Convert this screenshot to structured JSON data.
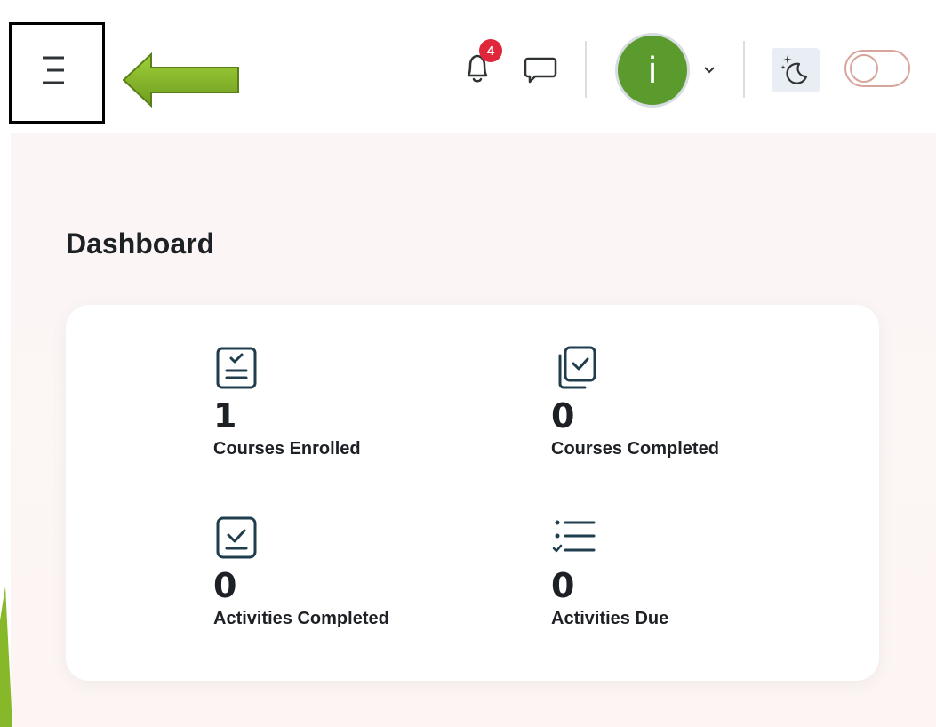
{
  "header": {
    "notifications": {
      "count": "4",
      "icon": "bell-icon"
    },
    "messages": {
      "icon": "chat-bubble-icon"
    },
    "user": {
      "initial": "i",
      "avatar_color": "#5b9a2c"
    },
    "theme": {
      "icon": "moon-stars-icon",
      "toggle_on": false
    }
  },
  "dashboard": {
    "title": "Dashboard",
    "stats": [
      {
        "value": "1",
        "label": "Courses Enrolled",
        "icon": "clipboard-check-icon"
      },
      {
        "value": "0",
        "label": "Courses Completed",
        "icon": "stacked-check-icon"
      },
      {
        "value": "0",
        "label": "Activities Completed",
        "icon": "checkbox-icon"
      },
      {
        "value": "0",
        "label": "Activities Due",
        "icon": "checklist-icon"
      }
    ]
  },
  "colors": {
    "accent_green": "#87b82a",
    "badge_red": "#e0263b",
    "text_dark": "#1d2125",
    "page_bg": "#fbf6f5"
  }
}
